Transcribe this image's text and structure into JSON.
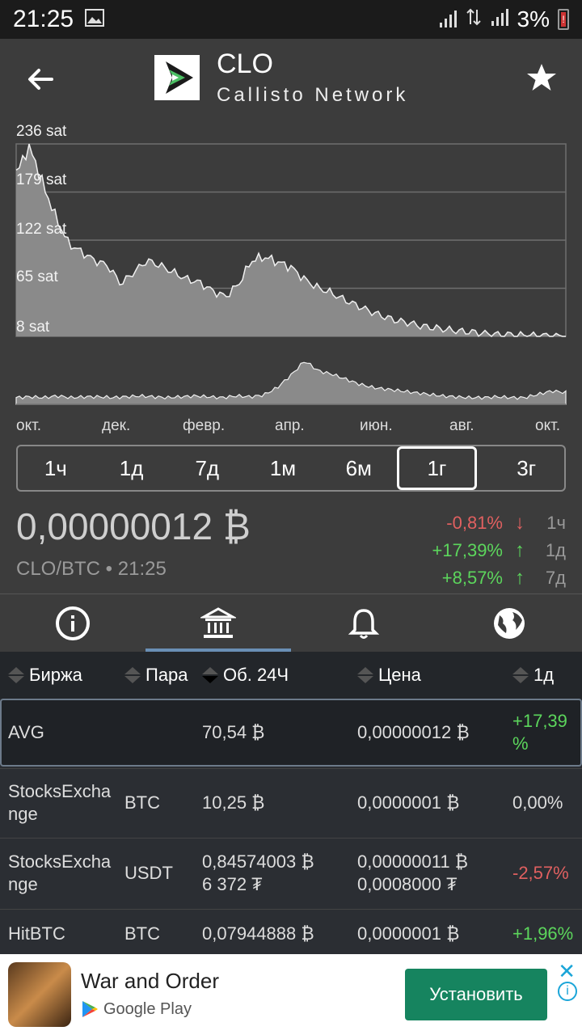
{
  "status": {
    "time": "21:25",
    "battery": "3%"
  },
  "header": {
    "symbol": "CLO",
    "name": "Callisto Network"
  },
  "chart": {
    "y_labels": [
      "236 sat",
      "179 sat",
      "122 sat",
      "65 sat",
      "8 sat"
    ],
    "x_labels": [
      "окт.",
      "дек.",
      "февр.",
      "апр.",
      "июн.",
      "авг.",
      "окт."
    ],
    "colors": {
      "area": "#8a8a8a",
      "line": "#f0f0f0",
      "grid": "#6e6e6e"
    }
  },
  "chart_data": {
    "type": "area",
    "ylabel_unit": "sat",
    "ylim": [
      8,
      236
    ],
    "x_ticks": [
      "окт.",
      "дек.",
      "февр.",
      "апр.",
      "июн.",
      "авг.",
      "окт."
    ],
    "price": [
      200,
      236,
      190,
      150,
      118,
      108,
      98,
      92,
      70,
      84,
      98,
      92,
      84,
      76,
      72,
      62,
      55,
      70,
      98,
      102,
      96,
      90,
      76,
      66,
      60,
      52,
      45,
      38,
      32,
      27,
      24,
      20,
      18,
      16,
      14,
      13,
      11,
      10,
      10,
      9,
      9,
      8,
      8
    ],
    "volume": [
      8,
      9,
      8,
      10,
      8,
      9,
      9,
      8,
      9,
      10,
      9,
      8,
      9,
      10,
      9,
      8,
      10,
      9,
      11,
      20,
      35,
      52,
      40,
      36,
      30,
      24,
      20,
      18,
      16,
      14,
      12,
      10,
      9,
      8,
      8,
      9,
      8,
      8,
      12,
      16,
      14
    ]
  },
  "ranges": [
    "1ч",
    "1д",
    "7д",
    "1м",
    "6м",
    "1г",
    "3г"
  ],
  "active_range": "1г",
  "price": {
    "value": "0,00000012 ₿",
    "pair": "CLO/BTC • 21:25"
  },
  "changes": [
    {
      "pct": "-0,81%",
      "arrow": "↓",
      "period": "1ч",
      "color": "red"
    },
    {
      "pct": "+17,39%",
      "arrow": "↑",
      "period": "1д",
      "color": "green"
    },
    {
      "pct": "+8,57%",
      "arrow": "↑",
      "period": "7д",
      "color": "green"
    }
  ],
  "tabs": [
    "info",
    "exchanges",
    "alerts",
    "web"
  ],
  "table": {
    "headers": {
      "exchange": "Биржа",
      "pair": "Пара",
      "volume": "Об. 24Ч",
      "price": "Цена",
      "change": "1д"
    },
    "rows": [
      {
        "exchange": "AVG",
        "pair": "",
        "volume": "70,54 ₿",
        "volume2": "",
        "price": "0,00000012 ₿",
        "price2": "",
        "change": "+17,39 %",
        "color": "green"
      },
      {
        "exchange": "StocksExchange",
        "pair": "BTC",
        "volume": "10,25 ₿",
        "volume2": "",
        "price": "0,0000001 ₿",
        "price2": "",
        "change": "0,00%",
        "color": "neutral"
      },
      {
        "exchange": "StocksExchange",
        "pair": "USDT",
        "volume": "0,84574003 ₿",
        "volume2": "6 372 ₮",
        "price": "0,00000011 ₿",
        "price2": "0,0008000 ₮",
        "change": "-2,57%",
        "color": "red"
      },
      {
        "exchange": "HitBTC",
        "pair": "BTC",
        "volume": "0,07944888 ₿",
        "volume2": "",
        "price": "0,0000001 ₿",
        "price2": "",
        "change": "+1,96%",
        "color": "green"
      }
    ]
  },
  "ad": {
    "title": "War and Order",
    "store": "Google Play",
    "button": "Установить"
  }
}
